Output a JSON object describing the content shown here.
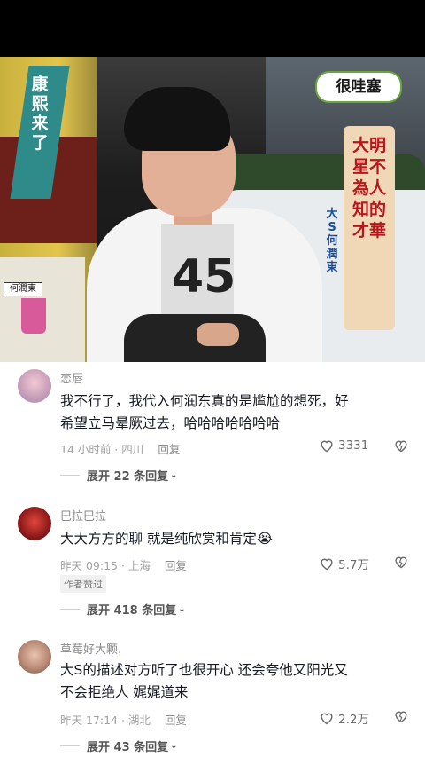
{
  "video": {
    "show_logo": "康熙来了",
    "brand_tag": "很哇塞",
    "banner_title": "大明星不為人知的才華",
    "subtitle_names": "大S 何潤東",
    "nameplate": "何潤東",
    "shirt_print": "45"
  },
  "comments": [
    {
      "username": "恋唇",
      "text": "我不行了，我代入何润东真的是尴尬的想死，好希望立马晕厥过去，哈哈哈哈哈哈哈",
      "time_location": "14 小时前 · 四川",
      "reply_label": "回复",
      "likes": "3331",
      "badge": "",
      "expand_label": "展开 22 条回复"
    },
    {
      "username": "巴拉巴拉",
      "text": "大大方方的聊 就是纯欣赏和肯定😭",
      "time_location": "昨天 09:15 · 上海",
      "reply_label": "回复",
      "likes": "5.7万",
      "badge": "作者赞过",
      "expand_label": "展开 418 条回复"
    },
    {
      "username": "草莓好大颗.",
      "text": "大S的描述对方听了也很开心 还会夸他又阳光又不会拒绝人 娓娓道来",
      "time_location": "昨天 17:14 · 湖北",
      "reply_label": "回复",
      "likes": "2.2万",
      "badge": "",
      "expand_label": "展开 43 条回复"
    }
  ],
  "icons": {
    "like": "heart-outline-icon",
    "dislike": "broken-heart-icon",
    "expand": "chevron-down-icon"
  },
  "colors": {
    "text_primary": "#161823",
    "text_secondary": "#8a8a8a",
    "background": "#ffffff"
  }
}
